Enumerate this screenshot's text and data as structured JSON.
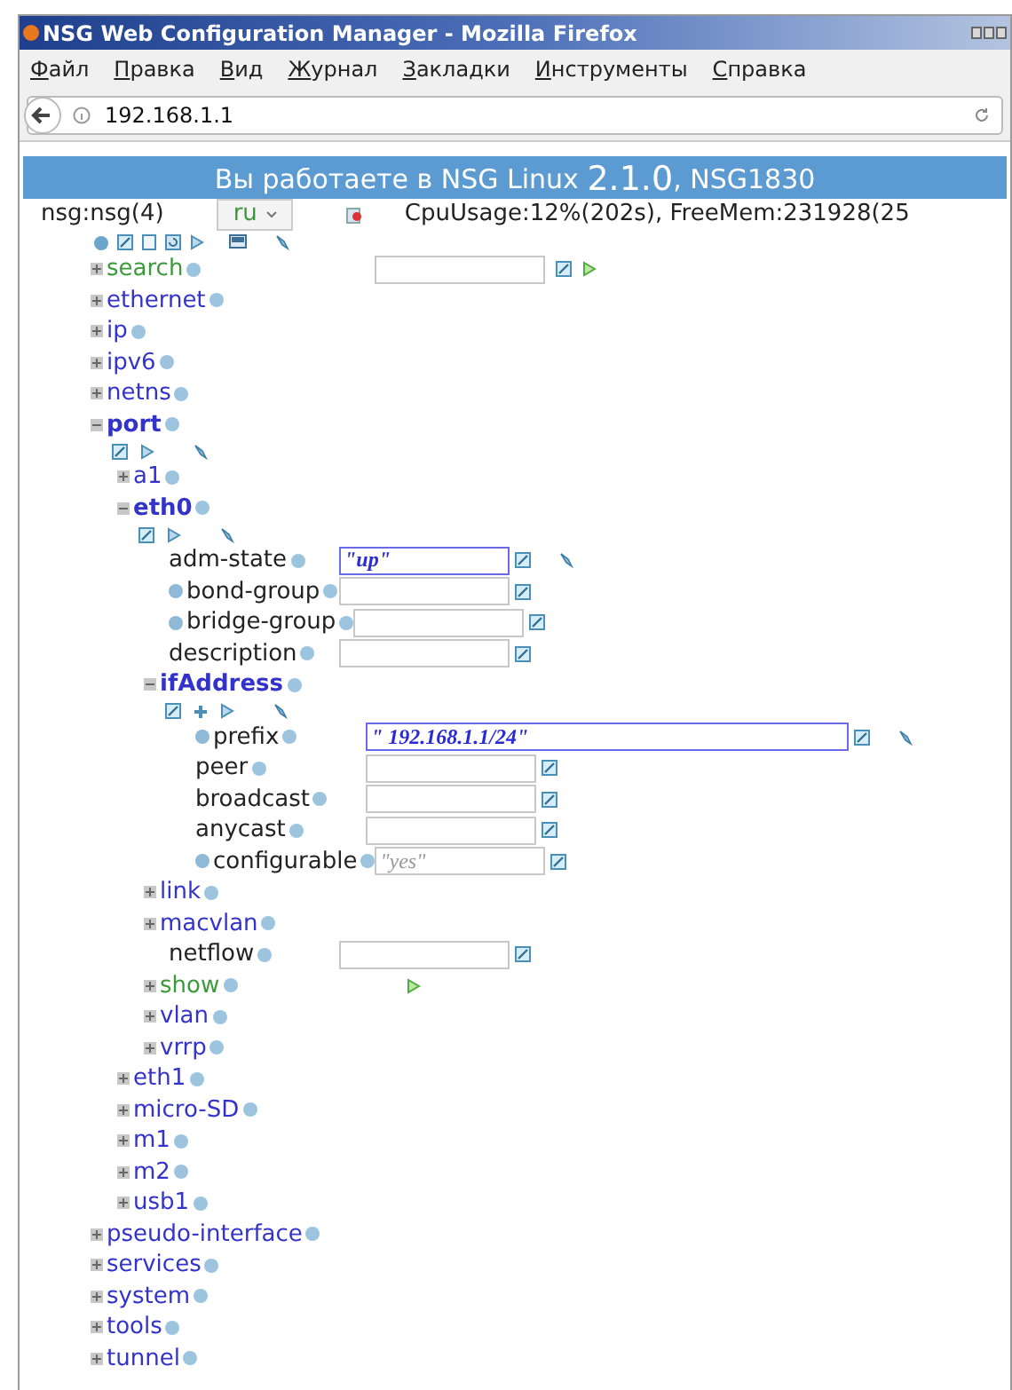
{
  "window": {
    "title": "NSG Web Configuration Manager - Mozilla Firefox"
  },
  "menu": [
    "Файл",
    "Правка",
    "Вид",
    "Журнал",
    "Закладки",
    "Инструменты",
    "Справка"
  ],
  "address": "192.168.1.1",
  "banner": {
    "before": "Вы работаете в NSG Linux ",
    "version": "2.1.0",
    "after": ", NSG1830"
  },
  "status": {
    "session": "nsg:nsg(4)",
    "language": "ru",
    "system": "CpuUsage:12%(202s), FreeMem:231928(25"
  },
  "tree": [
    {
      "kind": "command-input",
      "label": "search",
      "expanded": false
    },
    {
      "kind": "node",
      "label": "ethernet",
      "expanded": false
    },
    {
      "kind": "node",
      "label": "ip",
      "expanded": false
    },
    {
      "kind": "node",
      "label": "ipv6",
      "expanded": false
    },
    {
      "kind": "node",
      "label": "netns",
      "expanded": false
    },
    {
      "kind": "node",
      "label": "port",
      "expanded": true,
      "children": [
        {
          "kind": "node",
          "label": "a1",
          "expanded": false
        },
        {
          "kind": "node",
          "label": "eth0",
          "expanded": true,
          "children": [
            {
              "kind": "param",
              "label": "adm-state",
              "optional": false,
              "value": "\"up\""
            },
            {
              "kind": "param",
              "label": "bond-group",
              "optional": true
            },
            {
              "kind": "param",
              "label": "bridge-group",
              "optional": true
            },
            {
              "kind": "param",
              "label": "description",
              "optional": false
            },
            {
              "kind": "node",
              "label": "ifAddress",
              "expanded": true,
              "children": [
                {
                  "kind": "param",
                  "label": "prefix",
                  "optional": true,
                  "value": "\" 192.168.1.1/24\""
                },
                {
                  "kind": "param",
                  "label": "peer",
                  "optional": false
                },
                {
                  "kind": "param",
                  "label": "broadcast",
                  "optional": false
                },
                {
                  "kind": "param",
                  "label": "anycast",
                  "optional": false
                },
                {
                  "kind": "param",
                  "label": "configurable",
                  "optional": true,
                  "placeholder": "\"yes\""
                }
              ]
            },
            {
              "kind": "node",
              "label": "link",
              "expanded": false
            },
            {
              "kind": "node",
              "label": "macvlan",
              "expanded": false
            },
            {
              "kind": "param",
              "label": "netflow",
              "optional": false
            },
            {
              "kind": "command",
              "label": "show",
              "expanded": false
            },
            {
              "kind": "node",
              "label": "vlan",
              "expanded": false
            },
            {
              "kind": "node",
              "label": "vrrp",
              "expanded": false
            }
          ]
        },
        {
          "kind": "node",
          "label": "eth1",
          "expanded": false
        },
        {
          "kind": "node",
          "label": "micro-SD",
          "expanded": false
        },
        {
          "kind": "node",
          "label": "m1",
          "expanded": false
        },
        {
          "kind": "node",
          "label": "m2",
          "expanded": false
        },
        {
          "kind": "node",
          "label": "usb1",
          "expanded": false
        }
      ]
    },
    {
      "kind": "node",
      "label": "pseudo-interface",
      "expanded": false
    },
    {
      "kind": "node",
      "label": "services",
      "expanded": false
    },
    {
      "kind": "node",
      "label": "system",
      "expanded": false
    },
    {
      "kind": "node",
      "label": "tools",
      "expanded": false
    },
    {
      "kind": "node",
      "label": "tunnel",
      "expanded": false
    }
  ]
}
